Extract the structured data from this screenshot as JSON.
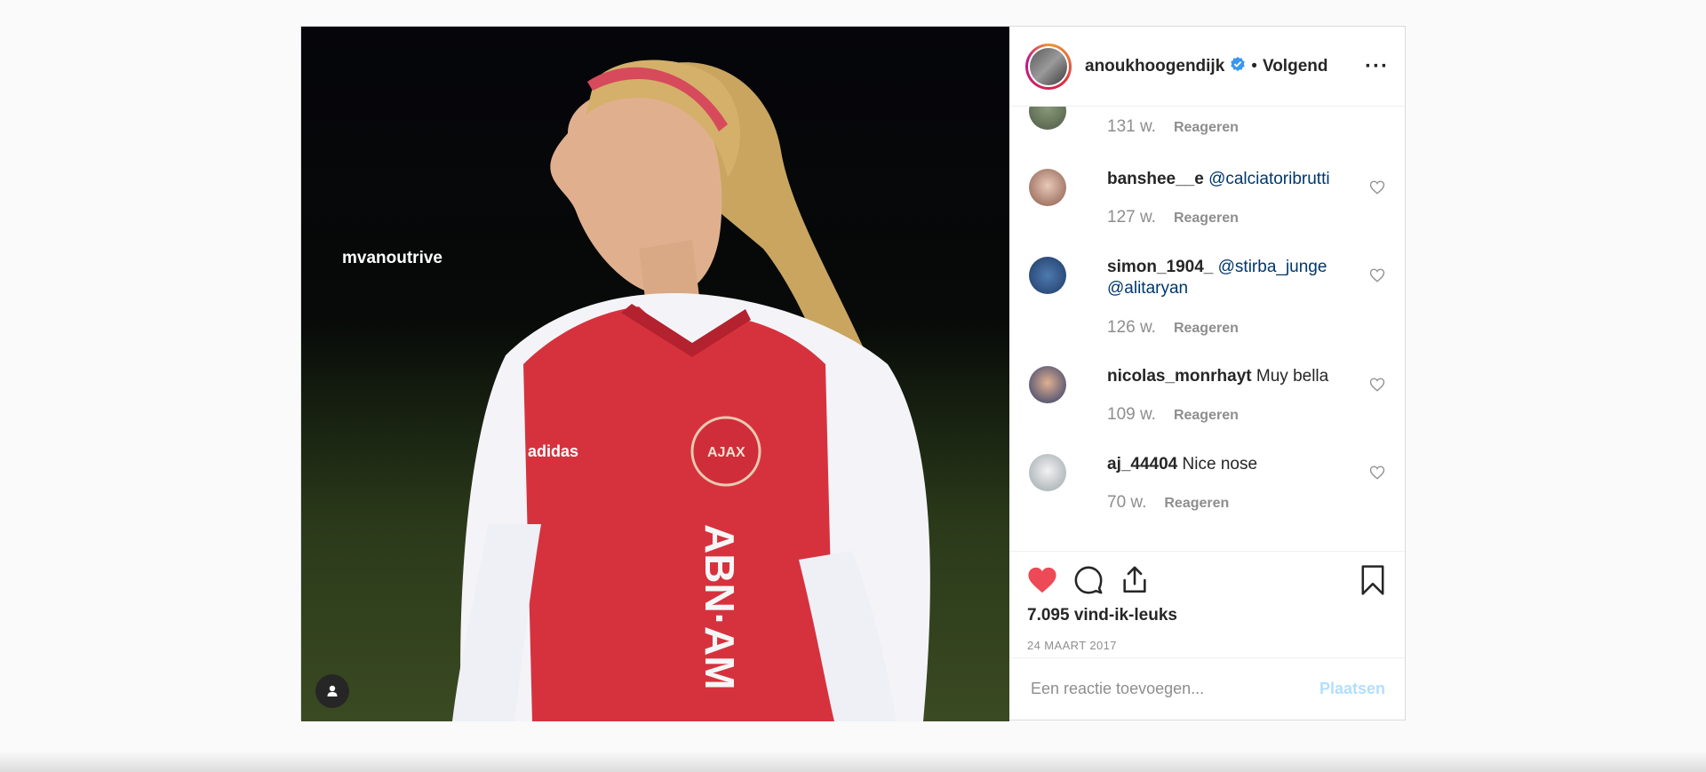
{
  "media": {
    "tag_username": "mvanoutrive",
    "user_tag_icon": "person-icon"
  },
  "header": {
    "username": "anoukhoogendijk",
    "separator": "•",
    "follow_label": "Volgend",
    "more_label": "···"
  },
  "comments": [
    {
      "time": "131 w.",
      "reply": "Reageren"
    },
    {
      "user": "banshee__e",
      "text": "",
      "mention": "@calciatoribrutti",
      "time": "127 w.",
      "reply": "Reageren"
    },
    {
      "user": "simon_1904_",
      "text": "",
      "mention": "@stirba_junge",
      "mention2": "@alitaryan",
      "time": "126 w.",
      "reply": "Reageren"
    },
    {
      "user": "nicolas_monrhayt",
      "text": "Muy bella",
      "time": "109 w.",
      "reply": "Reageren"
    },
    {
      "user": "aj_44404",
      "text": "Nice nose",
      "time": "70 w.",
      "reply": "Reageren"
    }
  ],
  "actions": {
    "likes": "7.095 vind-ik-leuks",
    "date": "24 MAART 2017",
    "liked_color": "#ed4956"
  },
  "add_comment": {
    "placeholder": "Een reactie toevoegen...",
    "post_label": "Plaatsen"
  }
}
